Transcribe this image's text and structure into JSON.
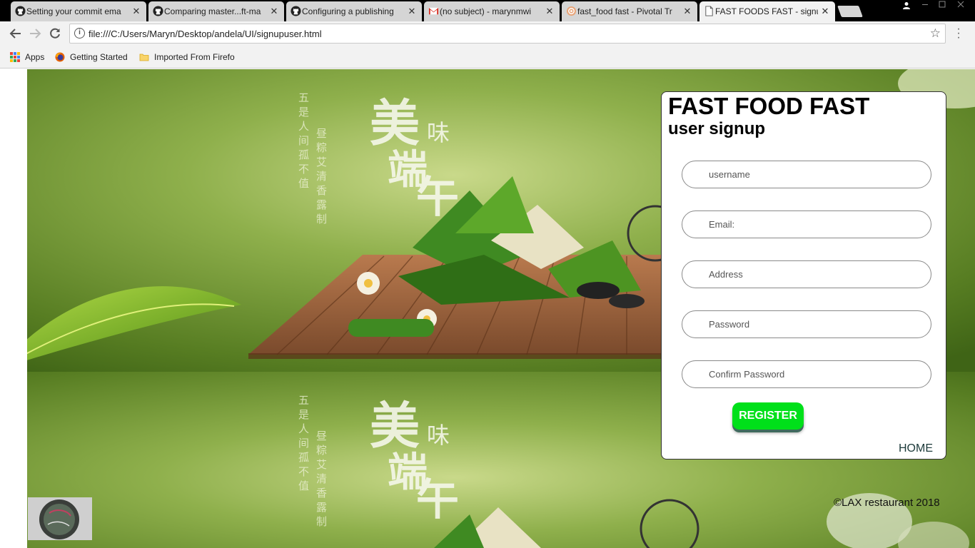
{
  "browser": {
    "tabs": [
      {
        "title": "Setting your commit ema",
        "icon": "github-icon",
        "active": false
      },
      {
        "title": "Comparing master...ft-ma",
        "icon": "github-icon",
        "active": false
      },
      {
        "title": "Configuring a publishing",
        "icon": "github-icon",
        "active": false
      },
      {
        "title": "(no subject) - marynmwi",
        "icon": "gmail-icon",
        "active": false
      },
      {
        "title": "fast_food fast - Pivotal Tr",
        "icon": "pivotal-tracker-icon",
        "active": false
      },
      {
        "title": "FAST FOODS FAST - signu",
        "icon": "document-icon",
        "active": true
      }
    ],
    "tab_close_glyph": "✕",
    "url": "file:///C:/Users/Maryn/Desktop/andela/UI/signupuser.html",
    "bookmarks": [
      {
        "label": "Apps",
        "icon": "apps-grid-icon"
      },
      {
        "label": "Getting Started",
        "icon": "firefox-icon"
      },
      {
        "label": "Imported From Firefo",
        "icon": "folder-icon"
      }
    ]
  },
  "page": {
    "title": "FAST FOOD FAST",
    "subtitle": "user signup",
    "form": {
      "username_placeholder": "username",
      "email_placeholder": "Email:",
      "address_placeholder": "Address",
      "password_placeholder": "Password",
      "confirm_placeholder": "Confirm Password",
      "register_label": "REGISTER"
    },
    "home_link": "HOME",
    "footer": "©LAX restaurant 2018",
    "background_art": "zongzi dragon boat festival banner",
    "colors": {
      "register_green": "#00e01a",
      "banner_green": "#6f9a2e"
    }
  }
}
